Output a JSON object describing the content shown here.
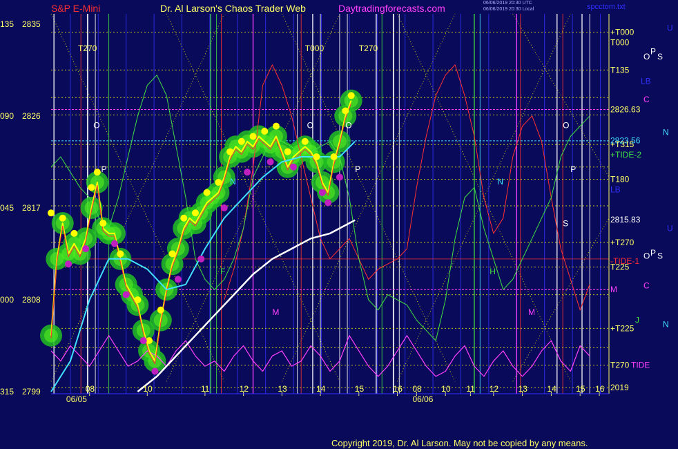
{
  "header": {
    "instrument": "S&P E-Mini",
    "title": "Dr. Al Larson's Chaos Trader Web",
    "site": "Daytradingforecasts.com",
    "stamp1": "06/06/2019 20:30 UTC",
    "stamp2": "06/06/2019 20:30 Local",
    "file": "spcctom.txt"
  },
  "copyright": "Copyright 2019, Dr. Al Larson. May not be copied by any means.",
  "colors": {
    "background": "#0a0a5a",
    "price_bars": "#ffff00",
    "flux_green": "#22c022",
    "flux_magenta": "#c020c0",
    "ema_fast": "#40e0ff",
    "ema_slow": "#ffffff",
    "red_line": "#ff3030",
    "green_line": "#40e040",
    "magenta_line": "#ff40ff",
    "grid": "#3030ff",
    "yellow_dotted": "#ffff00"
  },
  "chart_data": {
    "type": "line",
    "title": "S&P E-Mini",
    "y_axis": {
      "ticks": [
        {
          "deg": "135",
          "price": "2835",
          "value": 2835
        },
        {
          "deg": "090",
          "price": "2826",
          "value": 2826
        },
        {
          "deg": "045",
          "price": "2817",
          "value": 2817
        },
        {
          "deg": "000",
          "price": "2808",
          "value": 2808
        },
        {
          "deg": "315",
          "price": "2799",
          "value": 2799
        }
      ],
      "range": [
        2799,
        2835
      ]
    },
    "x_axis": {
      "range": [
        0,
        24
      ],
      "ticks": [
        {
          "x": 2,
          "label": "08"
        },
        {
          "x": 5,
          "label": "10"
        },
        {
          "x": 8,
          "label": "11"
        },
        {
          "x": 10,
          "label": "12"
        },
        {
          "x": 12,
          "label": "13"
        },
        {
          "x": 14,
          "label": "14"
        },
        {
          "x": 16,
          "label": "15"
        },
        {
          "x": 18,
          "label": "16"
        },
        {
          "x": 19,
          "label": "08"
        },
        {
          "x": 20.5,
          "label": "10"
        },
        {
          "x": 21.8,
          "label": "11"
        },
        {
          "x": 23,
          "label": "12"
        },
        {
          "x": 24.5,
          "label": "13"
        },
        {
          "x": 26,
          "label": "14"
        },
        {
          "x": 27.5,
          "label": "15"
        },
        {
          "x": 28.5,
          "label": "16"
        }
      ],
      "date_labels": [
        {
          "x": 0.5,
          "label": "06/05"
        },
        {
          "x": 18.5,
          "label": "06/06"
        }
      ]
    },
    "right_labels": [
      {
        "value": 2834.2,
        "label": "+T000",
        "color": "#ffff66"
      },
      {
        "value": 2833.2,
        "label": "T000",
        "color": "#ffff66"
      },
      {
        "value": 2830.5,
        "label": "T135",
        "color": "#ffff66"
      },
      {
        "value": 2826.63,
        "label": "2826.63",
        "color": "#ffff66"
      },
      {
        "value": 2823.6,
        "label": "2823.56",
        "color": "#40e0ff"
      },
      {
        "value": 2823.2,
        "label": "+T315",
        "color": "#ffff66"
      },
      {
        "value": 2822.2,
        "label": "+TIDE-2",
        "color": "#40e040"
      },
      {
        "value": 2819.8,
        "label": "T180",
        "color": "#ffff66"
      },
      {
        "value": 2818.8,
        "label": "LB",
        "color": "#3030ff"
      },
      {
        "value": 2815.83,
        "label": "2815.83",
        "color": "#ffffff"
      },
      {
        "value": 2813.6,
        "label": "+T270",
        "color": "#ffff66"
      },
      {
        "value": 2811.8,
        "label": "-TIDE-1",
        "color": "#ff3030"
      },
      {
        "value": 2811.2,
        "label": "T225",
        "color": "#ffff66"
      },
      {
        "value": 2809.0,
        "label": "M",
        "color": "#ff40ff"
      },
      {
        "value": 2805.2,
        "label": "+T225",
        "color": "#ffff66"
      },
      {
        "value": 2801.6,
        "label": "T270",
        "color": "#ffff66"
      },
      {
        "value": 2801.6,
        "label": "TIDE",
        "color": "#ff40ff"
      },
      {
        "value": 2799.4,
        "label": "2019",
        "color": "#ffff66"
      }
    ],
    "far_right_labels": [
      {
        "value": 2834.6,
        "label": "U",
        "color": "#3030ff"
      },
      {
        "value": 2832.3,
        "label": "P",
        "color": "#ffffff"
      },
      {
        "value": 2831.8,
        "label": "O",
        "color": "#ffffff"
      },
      {
        "value": 2831.8,
        "label": "S",
        "color": "#ffffff"
      },
      {
        "value": 2829.4,
        "label": "LB",
        "color": "#3030ff"
      },
      {
        "value": 2827.6,
        "label": "C",
        "color": "#ff40ff"
      },
      {
        "value": 2824.4,
        "label": "N",
        "color": "#40e0ff"
      },
      {
        "value": 2815.0,
        "label": "U",
        "color": "#3030ff"
      },
      {
        "value": 2812.6,
        "label": "P",
        "color": "#ffffff"
      },
      {
        "value": 2812.3,
        "label": "O",
        "color": "#ffffff"
      },
      {
        "value": 2812.3,
        "label": "S",
        "color": "#ffffff"
      },
      {
        "value": 2809.4,
        "label": "C",
        "color": "#ff40ff"
      },
      {
        "value": 2806.0,
        "label": "J",
        "color": "#40e040"
      },
      {
        "value": 2805.6,
        "label": "N",
        "color": "#40e0ff"
      }
    ],
    "top_labels": [
      {
        "x": 1.4,
        "label": "T270"
      },
      {
        "x": 13.2,
        "label": "T000"
      },
      {
        "x": 16.0,
        "label": "T270"
      }
    ],
    "event_letters": [
      {
        "x": 2.2,
        "y": 2824.8,
        "label": "O",
        "color": "#ffffff"
      },
      {
        "x": 2.6,
        "y": 2820.5,
        "label": "P",
        "color": "#ffffff"
      },
      {
        "x": 13.3,
        "y": 2824.8,
        "label": "O",
        "color": "#ffffff"
      },
      {
        "x": 15.3,
        "y": 2824.8,
        "label": "O",
        "color": "#ffffff"
      },
      {
        "x": 15.8,
        "y": 2820.5,
        "label": "P",
        "color": "#ffffff"
      },
      {
        "x": 26.6,
        "y": 2824.8,
        "label": "O",
        "color": "#ffffff"
      },
      {
        "x": 27.0,
        "y": 2820.5,
        "label": "P",
        "color": "#ffffff"
      },
      {
        "x": 9.3,
        "y": 2819.3,
        "label": "N",
        "color": "#40e0ff"
      },
      {
        "x": 23.2,
        "y": 2819.3,
        "label": "N",
        "color": "#40e0ff"
      },
      {
        "x": 26.6,
        "y": 2815.2,
        "label": "S",
        "color": "#ffffff"
      },
      {
        "x": 8.8,
        "y": 2810.5,
        "label": "F",
        "color": "#40e040"
      },
      {
        "x": 22.8,
        "y": 2810.5,
        "label": "H",
        "color": "#40e040"
      },
      {
        "x": 11.5,
        "y": 2806.5,
        "label": "M",
        "color": "#ff40ff"
      },
      {
        "x": 24.8,
        "y": 2806.5,
        "label": "M",
        "color": "#ff40ff"
      }
    ],
    "series": [
      {
        "name": "price",
        "color": "#ffff00",
        "x": [
          0,
          0.3,
          0.6,
          0.9,
          1.2,
          1.5,
          1.8,
          2.1,
          2.4,
          2.7,
          3.0,
          3.3,
          3.6,
          3.9,
          4.2,
          4.5,
          4.8,
          5.1,
          5.4,
          5.7,
          6.0,
          6.3,
          6.6,
          6.9,
          7.2,
          7.5,
          7.8,
          8.1,
          8.4,
          8.7,
          9.0,
          9.3,
          9.6,
          9.9,
          10.2,
          10.5,
          10.8,
          11.1,
          11.4,
          11.7,
          12.0,
          12.3,
          12.6,
          12.9,
          13.2,
          13.5,
          13.8,
          14.1,
          14.4,
          14.7,
          15.0,
          15.3,
          15.6
        ],
        "values": [
          2804.5,
          2812,
          2815.5,
          2812.5,
          2813.5,
          2812.5,
          2814,
          2817,
          2819.5,
          2815,
          2814.5,
          2814.5,
          2812,
          2809.5,
          2808.5,
          2807.5,
          2805,
          2803,
          2802,
          2806,
          2809,
          2811.5,
          2813,
          2815,
          2816,
          2815.5,
          2816.5,
          2817.5,
          2818,
          2818.5,
          2820,
          2822,
          2823,
          2822.5,
          2823.5,
          2823,
          2824,
          2823.5,
          2823,
          2824,
          2822.5,
          2821,
          2822,
          2822.5,
          2823,
          2822.5,
          2821.5,
          2819.5,
          2818.5,
          2821.5,
          2823.5,
          2826,
          2827.5
        ]
      },
      {
        "name": "fast-ema",
        "color": "#40e0ff",
        "x": [
          0,
          1,
          2,
          3,
          4,
          5,
          6,
          7,
          8,
          9,
          10,
          11,
          12,
          13,
          14,
          15,
          15.8
        ],
        "values": [
          2799,
          2802,
          2808,
          2812,
          2812,
          2811,
          2809,
          2809.5,
          2813,
          2816,
          2818,
          2820,
          2821.5,
          2822,
          2822,
          2822,
          2823.5
        ]
      },
      {
        "name": "slow-ema",
        "color": "#ffffff",
        "x": [
          4.5,
          5.5,
          6.5,
          7.5,
          8.5,
          9.5,
          10.5,
          11.5,
          12.5,
          13.5,
          14.5,
          15.8
        ],
        "values": [
          2799,
          2800.5,
          2802.5,
          2804.5,
          2806.5,
          2808.5,
          2810.5,
          2812,
          2813,
          2814,
          2814.5,
          2815.8
        ]
      },
      {
        "name": "green-cycle",
        "color": "#40e040",
        "x": [
          0,
          0.5,
          1,
          1.5,
          2,
          2.5,
          3,
          3.5,
          4,
          4.5,
          5,
          5.5,
          6,
          6.5,
          7,
          7.5,
          8,
          8.5,
          9,
          9.5,
          10,
          10.5,
          11,
          11.5,
          12,
          12.5,
          13,
          13.5,
          14,
          14.5,
          15,
          15.5,
          16,
          16.5,
          17,
          17.5,
          18,
          18.5,
          19,
          19.5,
          20,
          20.5,
          21,
          21.5,
          22,
          22.5,
          23,
          23.5,
          24,
          24.5,
          25,
          25.5,
          26,
          26.5,
          27,
          27.5,
          28
        ],
        "values": [
          2821,
          2822,
          2820.5,
          2819,
          2818,
          2816,
          2815,
          2818,
          2822,
          2826,
          2829,
          2830,
          2828,
          2823,
          2818,
          2812,
          2810,
          2809,
          2810,
          2812,
          2815,
          2820,
          2822,
          2824,
          2823.5,
          2823,
          2822,
          2822.5,
          2823,
          2823.5,
          2822,
          2818,
          2812,
          2808,
          2807,
          2808.5,
          2808,
          2807.5,
          2806,
          2805,
          2804,
          2808,
          2814,
          2818,
          2819,
          2815,
          2812,
          2809,
          2810,
          2812,
          2814,
          2816,
          2818,
          2822,
          2824,
          2825,
          2826
        ]
      },
      {
        "name": "red-cycle",
        "color": "#ff3030",
        "x": [
          9,
          9.5,
          10,
          10.5,
          11,
          11.5,
          12,
          12.5,
          13,
          13.5,
          14,
          14.5,
          15,
          15.5,
          16,
          16.5,
          17,
          17.5,
          18,
          18.5,
          19,
          19.5,
          20,
          20.5,
          21,
          21.5,
          22,
          22.5,
          23,
          23.5,
          24,
          24.5,
          25,
          25.5,
          26,
          26.5,
          27,
          27.5,
          28
        ],
        "values": [
          2808,
          2811,
          2815,
          2821,
          2829,
          2831,
          2829,
          2826,
          2822,
          2818,
          2814,
          2812,
          2813,
          2814,
          2812,
          2810,
          2811,
          2811.5,
          2812,
          2813,
          2819,
          2824,
          2828,
          2830,
          2831,
          2828,
          2824,
          2818,
          2814.5,
          2816,
          2822,
          2825,
          2826,
          2823.5,
          2818,
          2813,
          2810,
          2807,
          2809.5
        ]
      },
      {
        "name": "magenta-tide",
        "color": "#ff40ff",
        "x": [
          0,
          0.5,
          1,
          1.5,
          2,
          2.5,
          3,
          3.5,
          4,
          4.5,
          5,
          5.5,
          6,
          6.5,
          7,
          7.5,
          8,
          8.5,
          9,
          9.5,
          10,
          10.5,
          11,
          11.5,
          12,
          12.5,
          13,
          13.5,
          14,
          14.5,
          15,
          15.5,
          16,
          16.5,
          17,
          17.5,
          18,
          18.5,
          19,
          19.5,
          20,
          20.5,
          21,
          21.5,
          22,
          22.5,
          23,
          23.5,
          24,
          24.5,
          25,
          25.5,
          26,
          26.5,
          27,
          27.5,
          28
        ],
        "values": [
          2803,
          2802,
          2803.5,
          2802.5,
          2801.5,
          2803,
          2804.5,
          2803,
          2801.5,
          2802,
          2803,
          2802.5,
          2801.5,
          2803,
          2804,
          2802.5,
          2801.5,
          2802,
          2801,
          2802.5,
          2803.5,
          2802,
          2801,
          2802.5,
          2803,
          2801.5,
          2802,
          2803.5,
          2802.5,
          2801,
          2802,
          2804.5,
          2803,
          2801.5,
          2800.5,
          2801.5,
          2803,
          2804.5,
          2803,
          2801.5,
          2800.5,
          2801,
          2802.5,
          2803.5,
          2801.5,
          2800.5,
          2802,
          2803,
          2801.5,
          2800.5,
          2801.5,
          2803,
          2804,
          2802,
          2801,
          2803.5,
          2802.5
        ]
      }
    ],
    "flux_highs": {
      "x": [
        0,
        0.6,
        1.2,
        2.1,
        2.4,
        2.7,
        3.6,
        4.5,
        5.1,
        5.7,
        6.3,
        6.9,
        7.5,
        8.1,
        8.7,
        9.3,
        9.9,
        10.5,
        11.1,
        11.7,
        12.3,
        13.2,
        13.8,
        14.7,
        15.3,
        15.6
      ],
      "values": [
        2816.5,
        2816,
        2814.5,
        2819,
        2820.5,
        2815.5,
        2812.5,
        2808,
        2804,
        2807,
        2812.5,
        2816,
        2816.5,
        2818.5,
        2819.5,
        2822.5,
        2823.5,
        2824,
        2824.5,
        2825,
        2822.5,
        2823.5,
        2822,
        2822,
        2826.5,
        2828
      ]
    },
    "flux_lows": {
      "x": [
        0.9,
        1.8,
        3.3,
        3.9,
        4.8,
        5.4,
        6.6,
        7.8,
        9.0,
        10.2,
        11.4,
        12.6,
        14.1,
        14.4,
        15.0
      ],
      "values": [
        2811.5,
        2813,
        2813.5,
        2808.5,
        2804,
        2801,
        2810,
        2812,
        2817,
        2820.5,
        2821.5,
        2821,
        2818.5,
        2817.5,
        2820
      ]
    }
  }
}
